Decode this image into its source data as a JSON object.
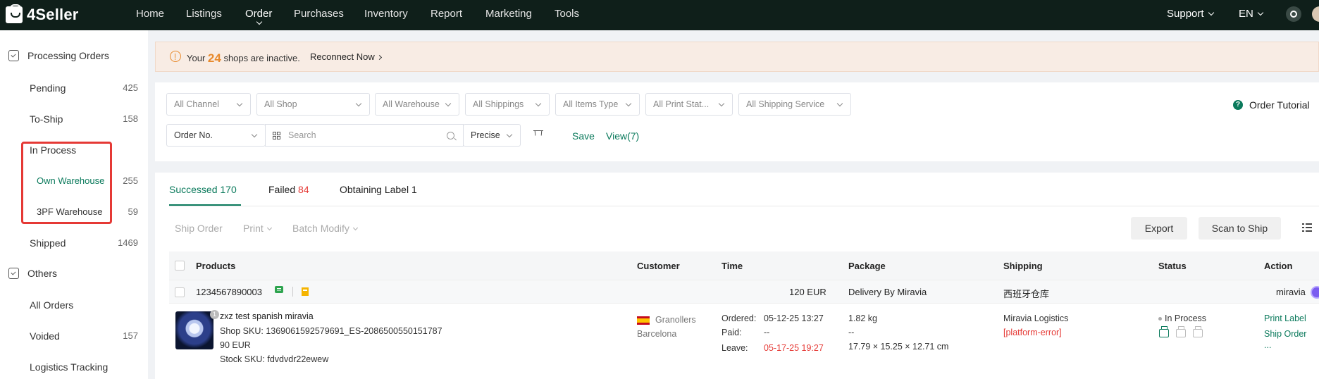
{
  "app": {
    "logo_text": "4Seller"
  },
  "topnav": {
    "items": [
      {
        "label": "Home"
      },
      {
        "label": "Listings"
      },
      {
        "label": "Order"
      },
      {
        "label": "Purchases"
      },
      {
        "label": "Inventory"
      },
      {
        "label": "Report"
      },
      {
        "label": "Marketing"
      },
      {
        "label": "Tools"
      }
    ],
    "active": "Order",
    "support_label": "Support",
    "lang_label": "EN"
  },
  "sidebar": {
    "processing_label": "Processing Orders",
    "items": [
      {
        "label": "Pending",
        "count": "425"
      },
      {
        "label": "To-Ship",
        "count": "158"
      },
      {
        "label": "In Process",
        "count": ""
      },
      {
        "label": "Own Warehouse",
        "count": "255"
      },
      {
        "label": "3PF Warehouse",
        "count": "59"
      },
      {
        "label": "Shipped",
        "count": "1469"
      }
    ],
    "others_label": "Others",
    "other_items": [
      {
        "label": "All Orders",
        "count": ""
      },
      {
        "label": "Voided",
        "count": "157"
      },
      {
        "label": "Logistics Tracking",
        "count": ""
      }
    ]
  },
  "banner": {
    "prefix": "Your",
    "count": "24",
    "suffix": "shops are inactive.",
    "link": "Reconnect Now"
  },
  "filters": {
    "dropdowns": [
      "All Channel",
      "All Shop",
      "All Warehouse",
      "All Shippings",
      "All Items Type",
      "All Print Stat...",
      "All Shipping Service"
    ],
    "search_field": "Order No.",
    "search_placeholder": "Search",
    "match_mode": "Precise",
    "save_label": "Save",
    "view_label": "View(7)",
    "tutorial_label": "Order Tutorial"
  },
  "tabs": [
    {
      "label": "Successed",
      "count": "170"
    },
    {
      "label": "Failed",
      "count": "84"
    },
    {
      "label": "Obtaining Label",
      "count": "1"
    }
  ],
  "toolbar": {
    "ship_order": "Ship Order",
    "print": "Print",
    "batch_modify": "Batch Modify",
    "export": "Export",
    "scan_to_ship": "Scan to Ship"
  },
  "table": {
    "headers": [
      "Products",
      "Customer",
      "Time",
      "Package",
      "Shipping",
      "Status",
      "Action"
    ],
    "group": {
      "order_no": "1234567890003",
      "amount": "120 EUR",
      "delivery": "Delivery By Miravia",
      "warehouse": "西班牙仓库",
      "platform": "miravia"
    },
    "order": {
      "badge": "1",
      "title": "zxz test spanish miravia",
      "shop_sku": "Shop SKU: 1369061592579691_ES-2086500550151787",
      "price": "90 EUR",
      "stock_sku": "Stock SKU: fdvdvdr22ewew",
      "city": "Granollers",
      "region": "Barcelona",
      "ordered_label": "Ordered:",
      "ordered_value": "05-12-25 13:27",
      "paid_label": "Paid:",
      "paid_value": "--",
      "leave_label": "Leave:",
      "leave_value": "05-17-25 19:27",
      "weight": "1.82 kg",
      "pkg_dash": "--",
      "dimensions": "17.79 × 15.25 × 12.71 cm",
      "carrier": "Miravia Logistics",
      "error": "[platform-error]",
      "status": "In Process",
      "actions": [
        "Print Label",
        "Ship Order",
        "..."
      ]
    }
  }
}
